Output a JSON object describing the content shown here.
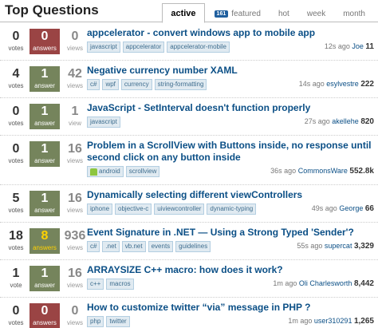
{
  "header": {
    "title": "Top Questions",
    "tabs": [
      {
        "label": "active",
        "active": true
      },
      {
        "label": "featured",
        "badge": "161"
      },
      {
        "label": "hot"
      },
      {
        "label": "week"
      },
      {
        "label": "month"
      }
    ]
  },
  "questions": [
    {
      "votes": "0",
      "votes_label": "votes",
      "answers": "0",
      "answers_label": "answers",
      "views": "0",
      "views_label": "views",
      "title": "appcelerator - convert windows app to mobile app",
      "tags": [
        "javascript",
        "appcelerator",
        "appcelerator-mobile"
      ],
      "time": "12s ago",
      "user": "Joe",
      "rep": "11"
    },
    {
      "votes": "4",
      "votes_label": "votes",
      "answers": "1",
      "answers_label": "answer",
      "views": "42",
      "views_label": "views",
      "title": "Negative currency number XAML",
      "tags": [
        "c#",
        "wpf",
        "currency",
        "string-formatting"
      ],
      "time": "14s ago",
      "user": "esylvestre",
      "rep": "222"
    },
    {
      "votes": "0",
      "votes_label": "votes",
      "answers": "1",
      "answers_label": "answer",
      "views": "1",
      "views_label": "view",
      "title": "JavaScript - SetInterval doesn't function properly",
      "tags": [
        "javascript"
      ],
      "time": "27s ago",
      "user": "akellehe",
      "rep": "820"
    },
    {
      "votes": "0",
      "votes_label": "votes",
      "answers": "1",
      "answers_label": "answer",
      "views": "16",
      "views_label": "views",
      "title": "Problem in a ScrollView with Buttons inside, no response until second click on any button inside",
      "tags": [
        "android",
        "scrollview"
      ],
      "time": "36s ago",
      "user": "CommonsWare",
      "rep": "552.8k"
    },
    {
      "votes": "5",
      "votes_label": "votes",
      "answers": "1",
      "answers_label": "answer",
      "views": "16",
      "views_label": "views",
      "title": "Dynamically selecting different viewControllers",
      "tags": [
        "iphone",
        "objective-c",
        "uiviewcontroller",
        "dynamic-typing"
      ],
      "time": "49s ago",
      "user": "George",
      "rep": "66"
    },
    {
      "votes": "18",
      "votes_label": "votes",
      "answers": "8",
      "answers_label": "answers",
      "views": "936",
      "views_label": "views",
      "title": "Event Signature in .NET — Using a Strong Typed 'Sender'?",
      "tags": [
        "c#",
        ".net",
        "vb.net",
        "events",
        "guidelines"
      ],
      "time": "55s ago",
      "user": "supercat",
      "rep": "3,329"
    },
    {
      "votes": "1",
      "votes_label": "vote",
      "answers": "1",
      "answers_label": "answer",
      "views": "16",
      "views_label": "views",
      "title": "ARRAYSIZE C++ macro: how does it work?",
      "tags": [
        "c++",
        "macros"
      ],
      "time": "1m ago",
      "user": "Oli Charlesworth",
      "rep": "8,442"
    },
    {
      "votes": "0",
      "votes_label": "votes",
      "answers": "0",
      "answers_label": "answers",
      "views": "0",
      "views_label": "views",
      "title": "How to customize twitter “via” message in PHP ?",
      "tags": [
        "php",
        "twitter"
      ],
      "time": "1m ago",
      "user": "user310291",
      "rep": "1,265"
    }
  ]
}
